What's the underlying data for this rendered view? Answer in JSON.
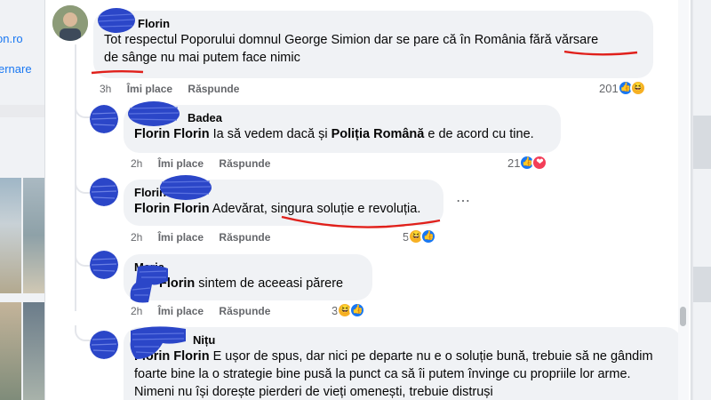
{
  "background": {
    "left_fragments": [
      "on.ro",
      "ernare"
    ]
  },
  "comments": [
    {
      "author": "Florin",
      "text_parts": [
        "Tot respectul Poporului domnul George Simion dar se pare că în România ",
        "fără vărsare",
        " ",
        "de sânge",
        " nu mai putem face nimic"
      ],
      "time": "3h",
      "like": "Îmi place",
      "reply": "Răspunde",
      "reaction_count": "201"
    },
    {
      "author": "Badea",
      "mention": "Florin Florin",
      "text_parts": [
        " Ia să vedem dacă și ",
        "Poliția Română",
        " e de acord cu tine."
      ],
      "time": "2h",
      "like": "Îmi place",
      "reply": "Răspunde",
      "reaction_count": "21"
    },
    {
      "author": "Florin",
      "mention": "Florin Florin",
      "text": " Adevărat, singura soluție e revoluția.",
      "time": "2h",
      "like": "Îmi place",
      "reply": "Răspunde",
      "reaction_count": "5"
    },
    {
      "author": "Maria",
      "mention": "Florin",
      "text": " sintem de aceeasi părere",
      "time": "2h",
      "like": "Îmi place",
      "reply": "Răspunde",
      "reaction_count": "3"
    },
    {
      "author": "Nițu",
      "mention": "Florin Florin",
      "text": " E ușor de spus, dar nici pe departe nu e o soluție bună, trebuie să ne gândim foarte bine la o strategie bine pusă la punct ca să îi putem învinge cu propriile lor arme. Nimeni nu își dorește pierderi de vieți omenești, trebuie distruși"
    }
  ],
  "icons": {
    "like": "like-reaction-icon",
    "haha": "haha-reaction-icon",
    "love": "love-reaction-icon",
    "more": "more-options-icon"
  },
  "colors": {
    "bubble": "#f0f2f5",
    "underline": "#e0201b",
    "scribble": "#2b46c8",
    "like_blue": "#1877f2"
  }
}
